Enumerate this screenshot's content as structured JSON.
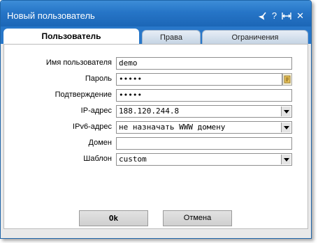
{
  "window": {
    "title": "Новый пользователь",
    "icons": [
      "broom-icon",
      "help-icon",
      "maximize-icon",
      "close-icon"
    ],
    "help_glyph": "?",
    "close_glyph": "✕"
  },
  "tabs": [
    {
      "label": "Пользователь",
      "active": true
    },
    {
      "label": "Права",
      "active": false
    },
    {
      "label": "Ограничения",
      "active": false
    }
  ],
  "form": {
    "username": {
      "label": "Имя пользователя",
      "value": "demo"
    },
    "password": {
      "label": "Пароль",
      "value": "•••••"
    },
    "confirm": {
      "label": "Подтверждение",
      "value": "•••••"
    },
    "ip": {
      "label": "IP-адрес",
      "value": "188.120.244.8"
    },
    "ipv6": {
      "label": "IPv6-адрес",
      "value": "не назначать WWW домену"
    },
    "domain": {
      "label": "Домен",
      "value": ""
    },
    "template": {
      "label": "Шаблон",
      "value": "custom"
    }
  },
  "buttons": {
    "ok": "Ok",
    "cancel": "Отмена"
  },
  "colors": {
    "titlebar": "#2675c7",
    "dialog_bg": "#e9e9e9"
  }
}
